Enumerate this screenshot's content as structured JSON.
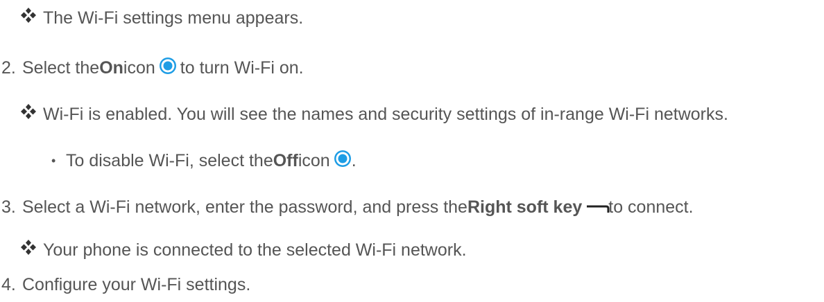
{
  "lines": {
    "result1": "The Wi-Fi settings menu appears.",
    "step2": {
      "num": "2.",
      "pre": "Select the ",
      "bold": "On",
      "mid": " icon",
      "post": " to turn Wi-Fi on."
    },
    "result2": "Wi-Fi is enabled. You will see the names and security settings of in-range Wi-Fi networks.",
    "bullet1": {
      "dot": "•",
      "pre": "To disable Wi-Fi, select the ",
      "bold": "Off",
      "mid": " icon",
      "post": "."
    },
    "step3": {
      "num": "3.",
      "pre": "Select a Wi-Fi network, enter the password, and press the ",
      "bold": "Right soft key",
      "post": " to connect."
    },
    "result3": "Your phone is connected to the selected Wi-Fi network.",
    "step4": {
      "num": "4.",
      "text": "Configure your Wi-Fi settings."
    }
  },
  "icons": {
    "result_marker": "diamond-cluster-icon",
    "on": "radio-on-icon",
    "off": "radio-on-icon",
    "softkey": "right-soft-key-icon"
  },
  "colors": {
    "text": "#555555",
    "radio_accent": "#1e9de5",
    "marker": "#333333"
  }
}
